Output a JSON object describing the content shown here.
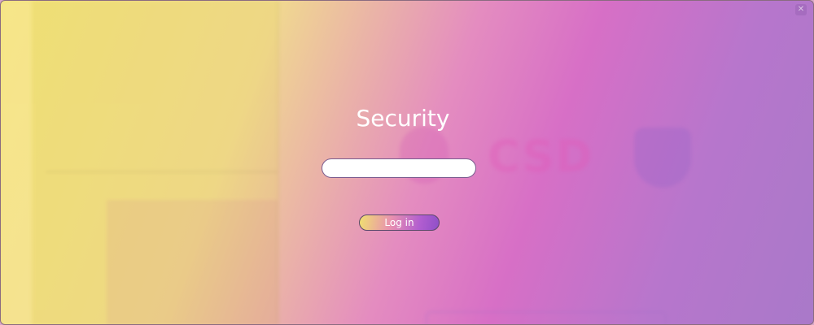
{
  "dialog": {
    "title": "Security",
    "password": {
      "value": "",
      "placeholder": ""
    },
    "login_label": "Log in"
  },
  "colors": {
    "gradient_start": "#f2e27a",
    "gradient_mid": "#d76fc6",
    "gradient_end": "#a979c9",
    "button_gradient_start": "#f0e070",
    "button_gradient_end": "#8f4fc8"
  }
}
